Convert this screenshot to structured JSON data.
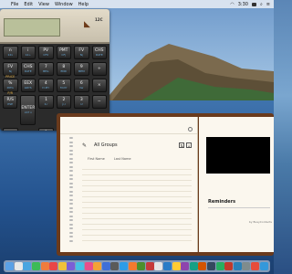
{
  "menubar": {
    "items": [
      "File",
      "Edit",
      "View",
      "Window",
      "Help"
    ],
    "clock": "3:30"
  },
  "calculator": {
    "model": "12C",
    "rows": [
      [
        {
          "top": "",
          "label": "n",
          "sub": "12x"
        },
        {
          "top": "",
          "label": "i",
          "sub": "12÷"
        },
        {
          "top": "",
          "label": "PV",
          "sub": "CF0"
        },
        {
          "top": "",
          "label": "PMT",
          "sub": "CFj"
        },
        {
          "top": "",
          "label": "FV",
          "sub": "Nj"
        },
        {
          "top": "",
          "label": "CHS",
          "sub": "DATE"
        }
      ],
      [
        {
          "top": "",
          "label": "FV",
          "sub": "Nj"
        },
        {
          "top": "",
          "label": "CHS",
          "sub": "DATE"
        },
        {
          "top": "",
          "label": "7",
          "sub": "BEG"
        },
        {
          "top": "",
          "label": "8",
          "sub": "END"
        },
        {
          "top": "",
          "label": "9",
          "sub": "MEM"
        },
        {
          "top": "",
          "label": "÷",
          "sub": ""
        }
      ],
      [
        {
          "top": "PRICE",
          "label": "%",
          "sub": "INTG"
        },
        {
          "top": "",
          "label": "EEX",
          "sub": "ΔDYS"
        },
        {
          "top": "",
          "label": "4",
          "sub": "D.MY"
        },
        {
          "top": "",
          "label": "5",
          "sub": "M.DY"
        },
        {
          "top": "",
          "label": "6",
          "sub": "x̄w"
        },
        {
          "top": "",
          "label": "×",
          "sub": ""
        }
      ],
      [
        {
          "top": "P/R",
          "label": "R/S",
          "sub": "PSE"
        },
        {
          "top": "",
          "label": "ENTER",
          "sub": "LST x"
        },
        {
          "top": "",
          "label": "1",
          "sub": "x̂,r"
        },
        {
          "top": "",
          "label": "2",
          "sub": "ŷ,r"
        },
        {
          "top": "",
          "label": "3",
          "sub": "n!"
        },
        {
          "top": "",
          "label": "−",
          "sub": ""
        }
      ],
      [
        {
          "top": "",
          "label": "RCL",
          "sub": ""
        },
        {
          "top": "",
          "label": "",
          "sub": ""
        },
        {
          "top": "",
          "label": "0",
          "sub": "x̄"
        },
        {
          "top": "",
          "label": "·",
          "sub": "s"
        },
        {
          "top": "",
          "label": "Σ+",
          "sub": "Σ−"
        },
        {
          "top": "",
          "label": "+",
          "sub": ""
        }
      ]
    ]
  },
  "notebook": {
    "groups_title": "All Groups",
    "field_first": "First Name",
    "field_last": "Last Name",
    "reminders_title": "Reminders",
    "footer": "by BusyContacts"
  },
  "dock": {
    "apps": [
      "#5aa0e6",
      "#e8e8e8",
      "#4aa5e0",
      "#3dbb56",
      "#ef7c3c",
      "#e94646",
      "#f0c13b",
      "#7a5fd6",
      "#46c1e6",
      "#e94f8a",
      "#f4a236",
      "#3f6fd8",
      "#5a5a5a",
      "#2d9ce8",
      "#f27a2f",
      "#4b8f2c",
      "#c63a3a",
      "#e6e6e6",
      "#2a7cc7",
      "#ffcc33",
      "#8e44ad",
      "#16a085",
      "#d35400",
      "#34495e",
      "#27ae60",
      "#c0392b",
      "#2980b9",
      "#7f8c8d",
      "#e74c3c",
      "#3498db"
    ]
  }
}
